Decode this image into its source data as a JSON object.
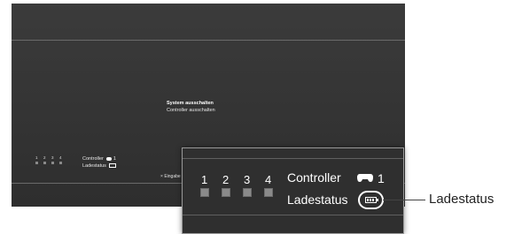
{
  "menu": {
    "selected": "System ausschalten",
    "option": "Controller ausschalten"
  },
  "controller": {
    "ports": [
      "1",
      "2",
      "3",
      "4"
    ],
    "label": "Controller",
    "number": "1",
    "charge_label": "Ladestatus",
    "controller_icon": "gamepad-icon",
    "battery_icon": "battery-icon"
  },
  "hint": {
    "button_icon": "×",
    "label": "Eingabe"
  },
  "callout": {
    "text": "Ladestatus"
  }
}
